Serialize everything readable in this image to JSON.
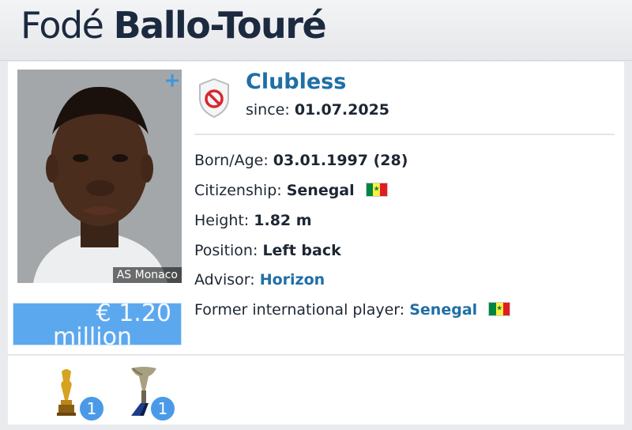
{
  "player": {
    "first_name": "Fodé",
    "last_name": "Ballo-Touré",
    "photo_caption": "AS Monaco"
  },
  "market_value": {
    "amount": "€ 1.20",
    "unit": "million"
  },
  "club": {
    "name": "Clubless",
    "since_label": "since:",
    "since_date": "01.07.2025"
  },
  "info": {
    "born_label": "Born/Age:",
    "born_value": "03.01.1997 (28)",
    "citizenship_label": "Citizenship:",
    "citizenship_value": "Senegal",
    "height_label": "Height:",
    "height_value": "1.82 m",
    "position_label": "Position:",
    "position_value": "Left back",
    "advisor_label": "Advisor:",
    "advisor_value": "Horizon",
    "former_label": "Former international player:",
    "former_value": "Senegal"
  },
  "trophies": [
    {
      "icon": "african-cup-trophy-icon",
      "count": "1"
    },
    {
      "icon": "league-trophy-icon",
      "count": "1"
    }
  ],
  "colors": {
    "accent_blue": "#1f6fa6",
    "market_value_bg": "#5ca8ee",
    "badge_blue": "#4a9ae8"
  }
}
